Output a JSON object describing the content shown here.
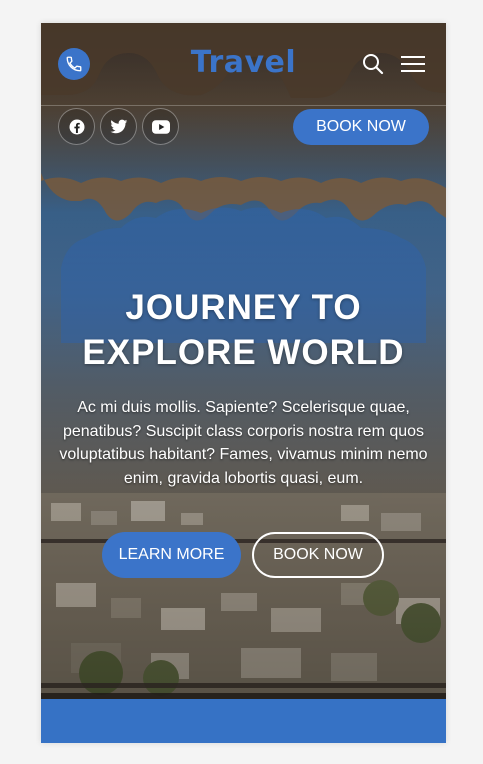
{
  "header": {
    "brand": "Travel",
    "phone_icon": "phone-icon",
    "search_icon": "search-icon",
    "menu_icon": "hamburger-menu-icon",
    "book_now_label": "BOOK NOW"
  },
  "social": [
    {
      "name": "facebook",
      "icon": "facebook-icon"
    },
    {
      "name": "twitter",
      "icon": "twitter-icon"
    },
    {
      "name": "youtube",
      "icon": "youtube-icon"
    }
  ],
  "hero": {
    "headline_line1": "JOURNEY TO",
    "headline_line2": "EXPLORE WORLD",
    "description": "Ac mi duis mollis. Sapiente? Scelerisque quae, penatibus? Suscipit class corporis nostra rem quos voluptatibus habitant? Fames, vivamus minim nemo enim, gravida lobortis quasi, eum.",
    "learn_more_label": "LEARN MORE",
    "book_now_label": "BOOK NOW"
  },
  "colors": {
    "accent": "#3b74c9",
    "band": "#3672c5",
    "text": "#ffffff"
  }
}
